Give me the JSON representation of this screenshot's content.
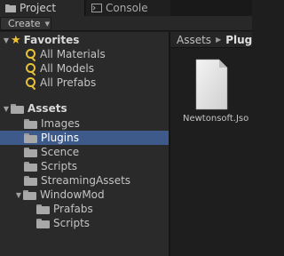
{
  "tabs": {
    "project": {
      "label": "Project",
      "icon": "folder-icon"
    },
    "console": {
      "label": "Console",
      "icon": "console-icon"
    }
  },
  "toolbar": {
    "create_label": "Create"
  },
  "favorites": {
    "label": "Favorites",
    "items": [
      {
        "label": "All Materials"
      },
      {
        "label": "All Models"
      },
      {
        "label": "All Prefabs"
      }
    ]
  },
  "assets": {
    "label": "Assets",
    "children": [
      {
        "label": "Images"
      },
      {
        "label": "Plugins",
        "selected": true
      },
      {
        "label": "Scence"
      },
      {
        "label": "Scripts"
      },
      {
        "label": "StreamingAssets"
      },
      {
        "label": "WindowMod",
        "expanded": true,
        "children": [
          {
            "label": "Prafabs"
          },
          {
            "label": "Scripts"
          }
        ]
      }
    ]
  },
  "browser": {
    "breadcrumb": [
      "Assets",
      "Plugins"
    ],
    "files": [
      {
        "name": "Newtonsoft.Json",
        "icon": "document-icon"
      }
    ]
  },
  "colors": {
    "selection": "#3d5a8a",
    "favorite_star": "#f2c230"
  }
}
